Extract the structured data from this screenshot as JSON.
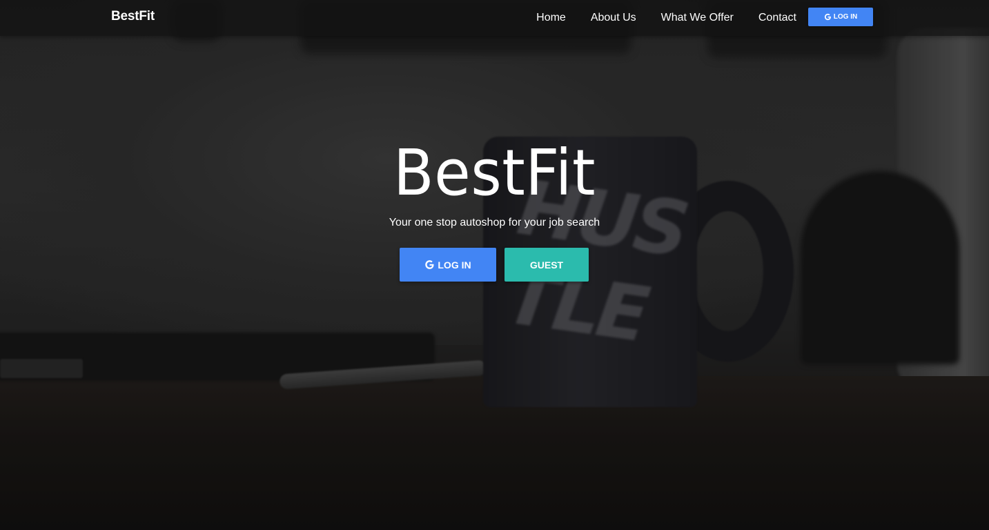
{
  "navbar": {
    "brand": "BestFit",
    "links": [
      "Home",
      "About Us",
      "What We Offer",
      "Contact"
    ],
    "login_label": "LOG IN",
    "login_icon": "google-icon",
    "login_color": "#4285f4"
  },
  "hero": {
    "title": "BestFit",
    "subtitle": "Your one stop autoshop for your job search",
    "buttons": {
      "login_label": "LOG IN",
      "login_icon": "google-icon",
      "login_color": "#4285f4",
      "guest_label": "GUEST",
      "guest_color": "#2bbbad"
    }
  }
}
